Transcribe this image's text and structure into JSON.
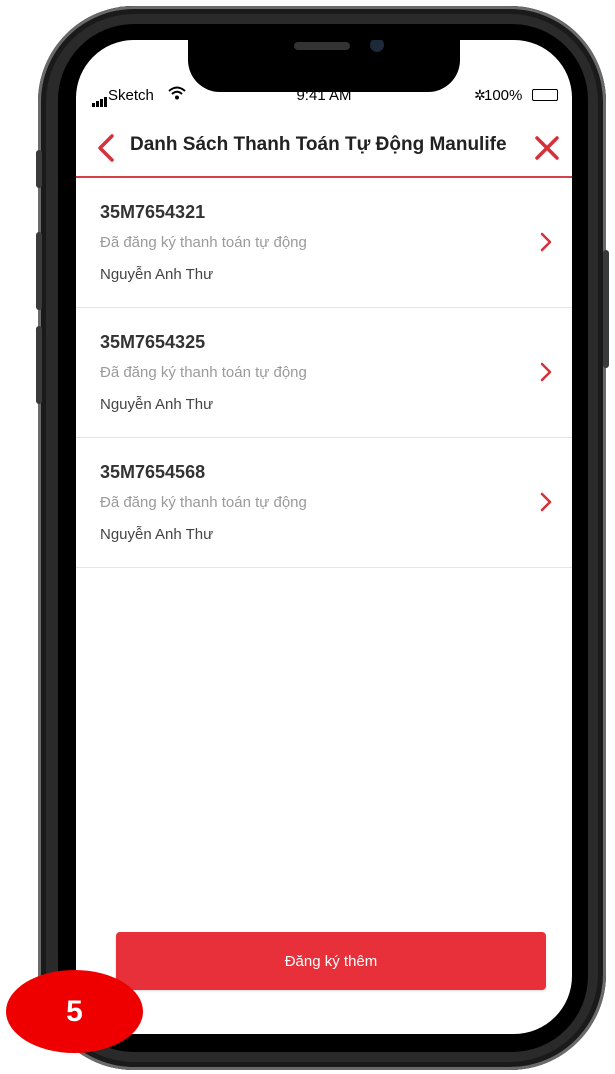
{
  "status_bar": {
    "carrier": "Sketch",
    "time": "9:41 AM",
    "battery": "100%",
    "bluetooth": "✲"
  },
  "nav": {
    "title": "Danh Sách Thanh Toán Tự Động Manulife",
    "back_icon": "chevron-left-icon",
    "close_icon": "close-icon"
  },
  "items": [
    {
      "id": "35M7654321",
      "status": "Đã đăng ký thanh toán tự động",
      "name": "Nguyễn Anh Thư"
    },
    {
      "id": "35M7654325",
      "status": "Đã đăng ký thanh toán tự động",
      "name": "Nguyễn Anh Thư"
    },
    {
      "id": "35M7654568",
      "status": "Đã đăng ký thanh toán tự động",
      "name": "Nguyễn Anh Thư"
    }
  ],
  "register_button": {
    "label": "Đăng ký thêm"
  },
  "step_badge": {
    "label": "5"
  },
  "colors": {
    "accent": "#e8303a",
    "divider": "#d6404a",
    "badge": "#ee0000"
  }
}
